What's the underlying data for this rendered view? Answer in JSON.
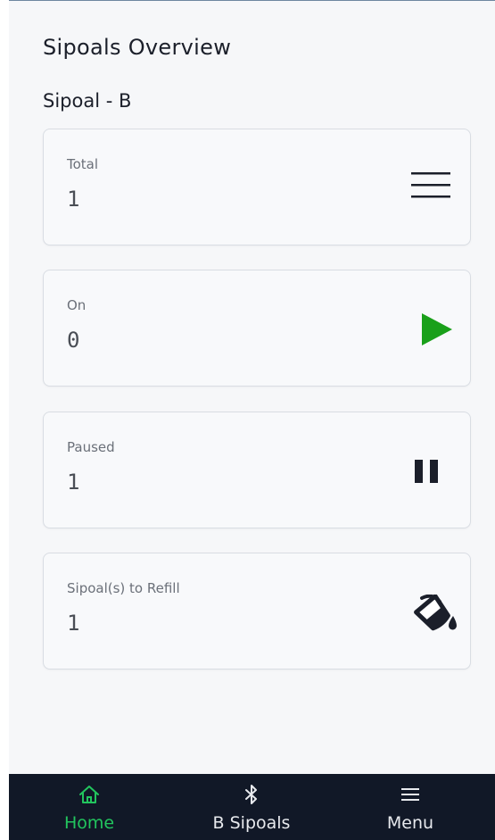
{
  "header": {
    "title": "Sipoals Overview"
  },
  "section": {
    "title": "Sipoal - B"
  },
  "cards": [
    {
      "label": "Total",
      "value": "1",
      "icon": "list-icon"
    },
    {
      "label": "On",
      "value": "0",
      "icon": "play-icon"
    },
    {
      "label": "Paused",
      "value": "1",
      "icon": "pause-icon"
    },
    {
      "label": "Sipoal(s) to Refill",
      "value": "1",
      "icon": "paint-bucket-icon"
    }
  ],
  "nav": {
    "items": [
      {
        "label": "Home",
        "icon": "home-icon",
        "active": true
      },
      {
        "label": "B Sipoals",
        "icon": "bluetooth-icon",
        "active": false
      },
      {
        "label": "Menu",
        "icon": "menu-icon",
        "active": false
      }
    ]
  },
  "colors": {
    "accent_green": "#22c55e",
    "play_green": "#1aa01a",
    "navbar_bg": "#111827"
  }
}
